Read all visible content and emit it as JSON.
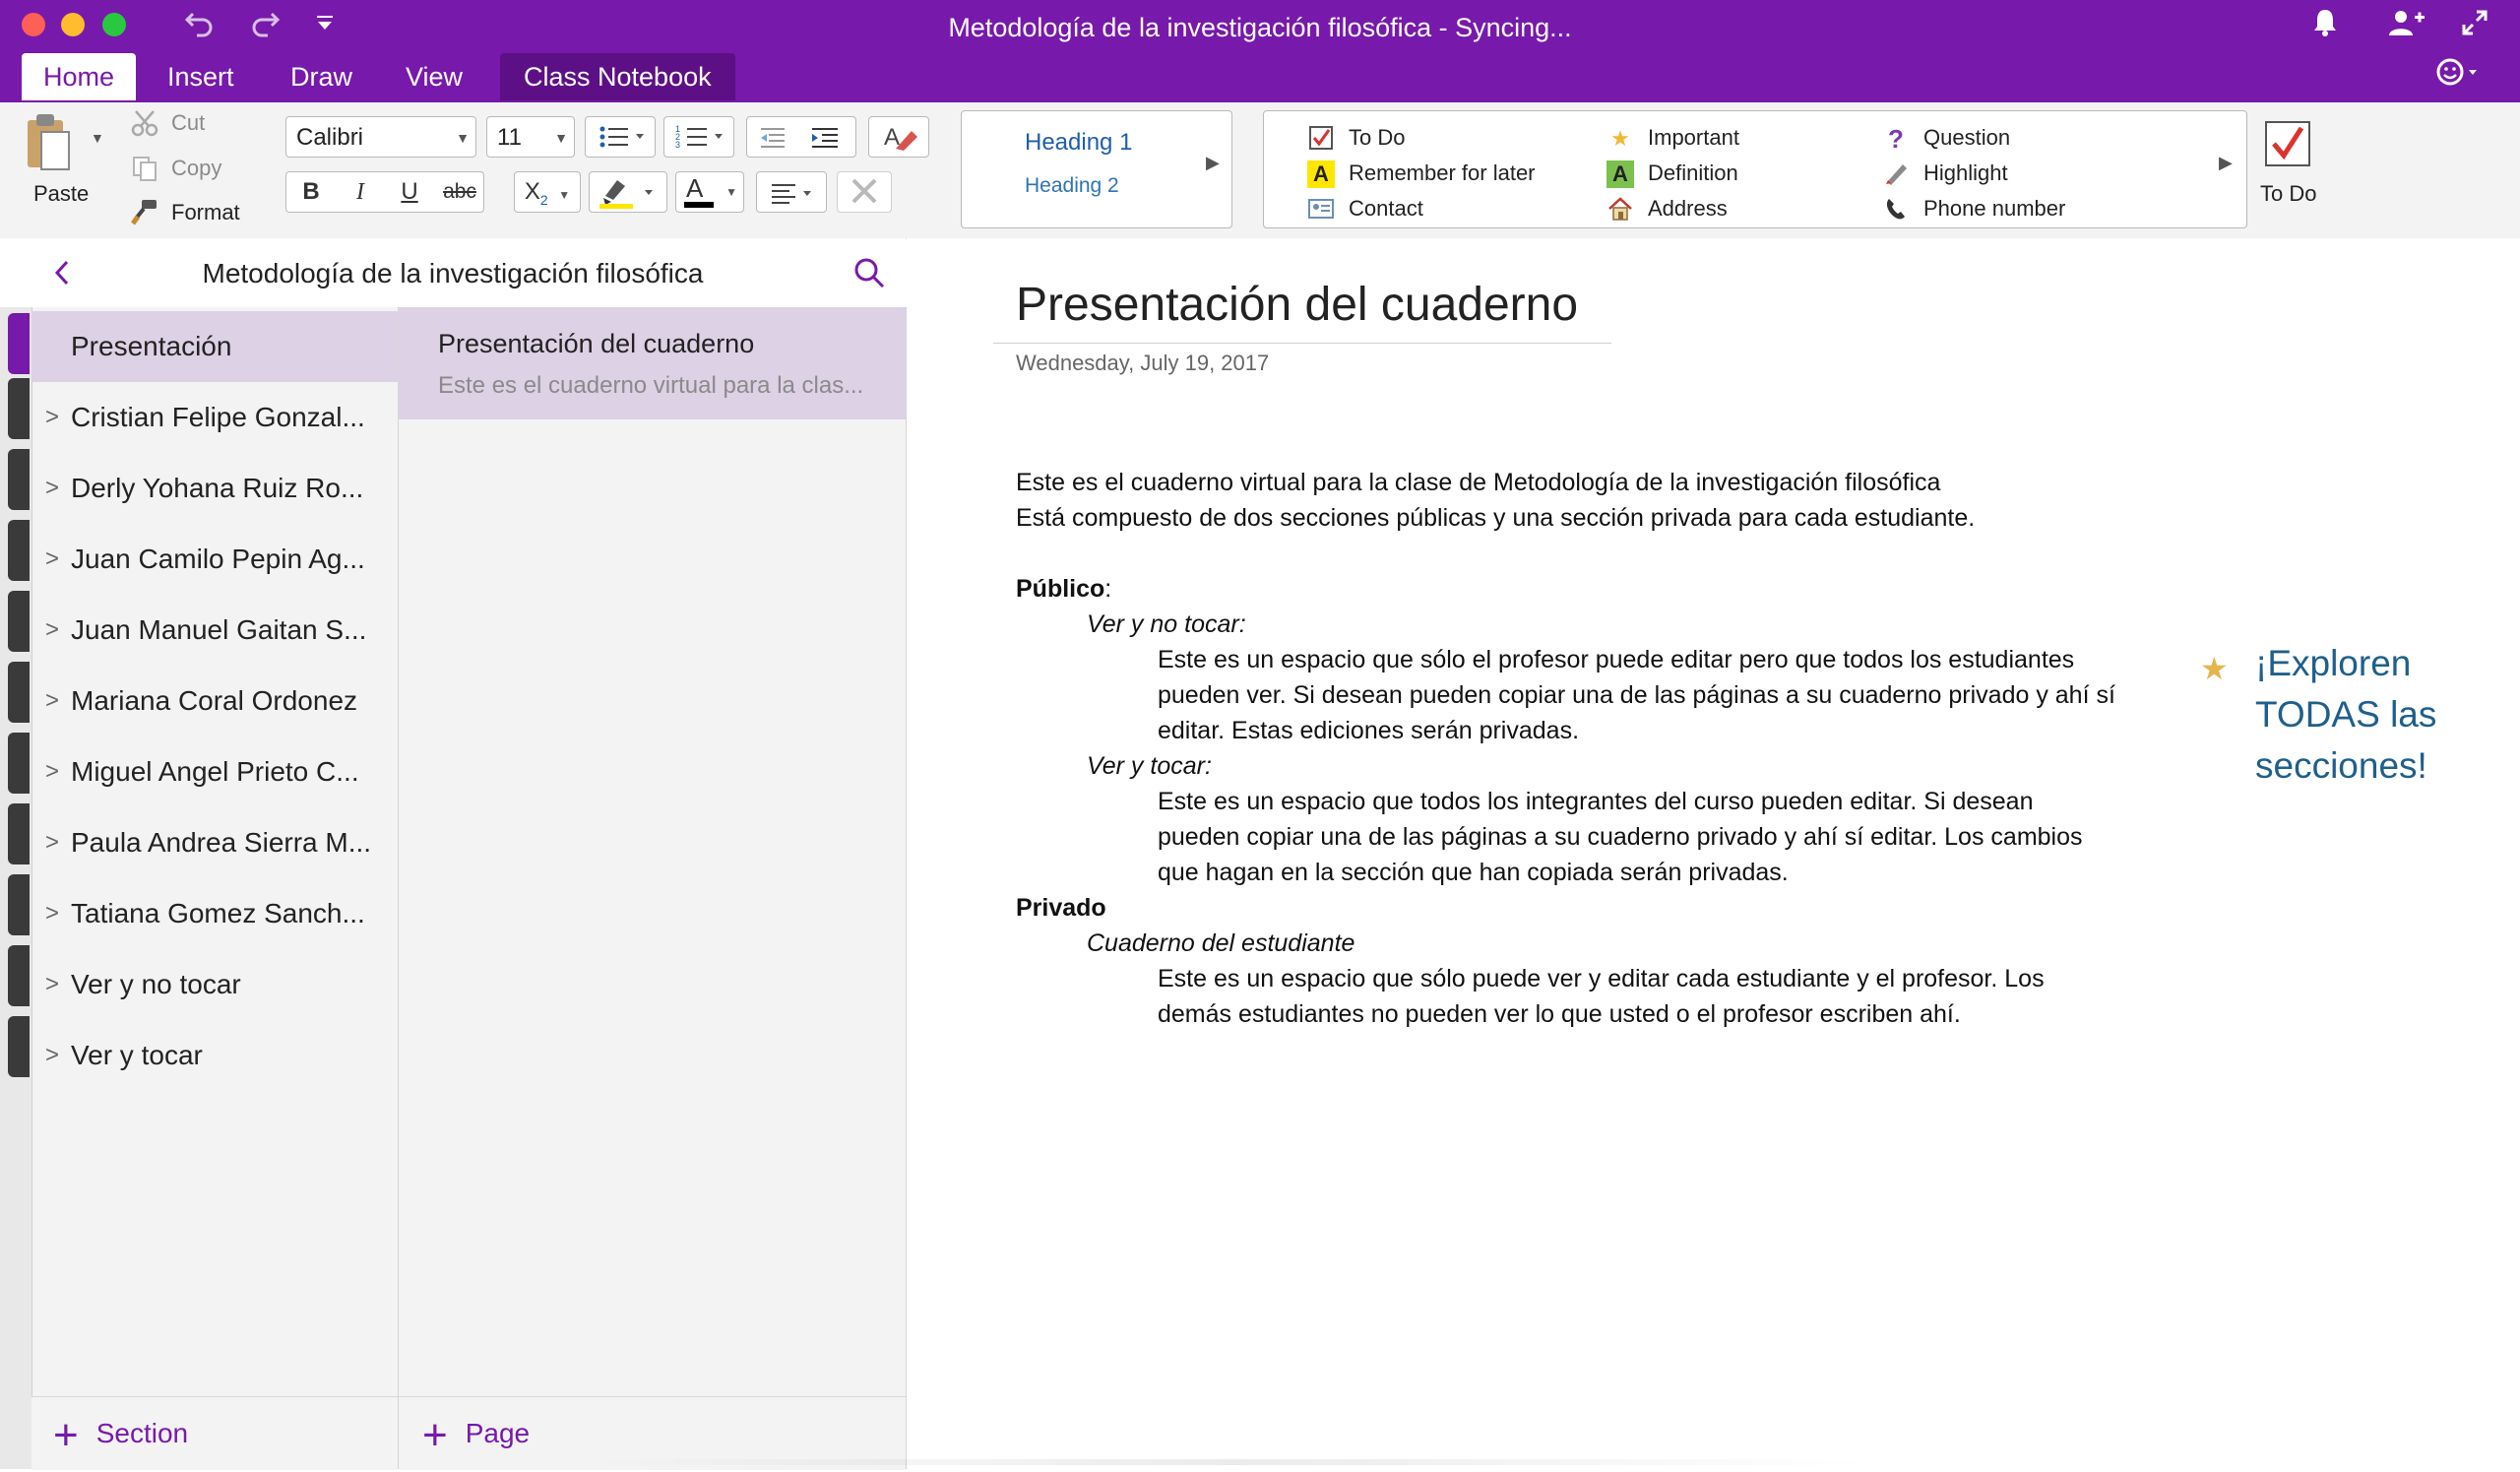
{
  "window": {
    "title": "Metodología de la investigación filosófica - Syncing..."
  },
  "tabs": [
    {
      "label": "Home"
    },
    {
      "label": "Insert"
    },
    {
      "label": "Draw"
    },
    {
      "label": "View"
    },
    {
      "label": "Class Notebook"
    }
  ],
  "ribbon": {
    "paste": "Paste",
    "cut": "Cut",
    "copy": "Copy",
    "format": "Format",
    "font_name": "Calibri",
    "font_size": "11",
    "bold": "B",
    "italic": "I",
    "underline": "U",
    "strikethrough": "abc",
    "subscript": "X",
    "subscript_index": "2",
    "font_color_letter": "A",
    "styles": [
      "Heading 1",
      "Heading 2"
    ],
    "tags": [
      {
        "label": "To Do",
        "icon": "checkbox-icon"
      },
      {
        "label": "Remember for later",
        "icon": "highlight-a-icon"
      },
      {
        "label": "Contact",
        "icon": "contact-card-icon"
      },
      {
        "label": "Important",
        "icon": "star-icon"
      },
      {
        "label": "Definition",
        "icon": "definition-a-icon"
      },
      {
        "label": "Address",
        "icon": "house-icon"
      },
      {
        "label": "Question",
        "icon": "question-icon"
      },
      {
        "label": "Highlight",
        "icon": "pen-icon"
      },
      {
        "label": "Phone number",
        "icon": "phone-icon"
      }
    ],
    "todo_label": "To Do"
  },
  "nav": {
    "notebook_title": "Metodología de la investigación filosófica",
    "sections": [
      {
        "label": "Presentación",
        "active": true
      },
      {
        "label": "Cristian Felipe Gonzal..."
      },
      {
        "label": "Derly Yohana Ruiz Ro..."
      },
      {
        "label": "Juan Camilo Pepin Ag..."
      },
      {
        "label": "Juan Manuel Gaitan S..."
      },
      {
        "label": "Mariana Coral Ordonez"
      },
      {
        "label": "Miguel Angel Prieto C..."
      },
      {
        "label": "Paula Andrea Sierra M..."
      },
      {
        "label": "Tatiana Gomez Sanch..."
      },
      {
        "label": "Ver y no tocar"
      },
      {
        "label": "Ver y tocar"
      }
    ],
    "pages": [
      {
        "title": "Presentación del cuaderno",
        "preview": "Este es el cuaderno virtual para la clas..."
      }
    ],
    "add_section": "Section",
    "add_page": "Page"
  },
  "note": {
    "title": "Presentación del cuaderno",
    "date": "Wednesday, July 19, 2017",
    "intro_1": "Este es el cuaderno virtual para la clase de Metodología de la investigación filosófica",
    "intro_2": "Está compuesto de dos secciones públicas y una sección privada para cada estudiante.",
    "publico": "Público",
    "colon": ":",
    "ver_no_tocar": "Ver y no tocar:",
    "ver_no_tocar_text": [
      "Este es un espacio que sólo el profesor puede editar pero que todos los estudiantes",
      "pueden ver. Si desean pueden copiar una de las páginas a su cuaderno privado y ahí sí",
      "editar. Estas ediciones serán privadas."
    ],
    "ver_tocar": "Ver y tocar:",
    "ver_tocar_text": [
      "Este es un espacio que todos los integrantes del curso pueden editar. Si desean",
      "pueden copiar una de las páginas a su cuaderno privado y ahí sí editar. Los cambios",
      "que hagan en la sección que han copiada serán privadas."
    ],
    "privado": "Privado",
    "cuaderno_estudiante": "Cuaderno del estudiante",
    "cuaderno_text": [
      "Este es un espacio que sólo puede ver y editar cada estudiante y el profesor. Los",
      "demás estudiantes no pueden ver lo que usted o el profesor escriben ahí."
    ],
    "callout": [
      "¡Exploren",
      "TODAS las",
      "secciones!"
    ]
  },
  "colors": {
    "brand": "#7719aa",
    "callout": "#1f5f8b",
    "star": "#e6b44c"
  }
}
